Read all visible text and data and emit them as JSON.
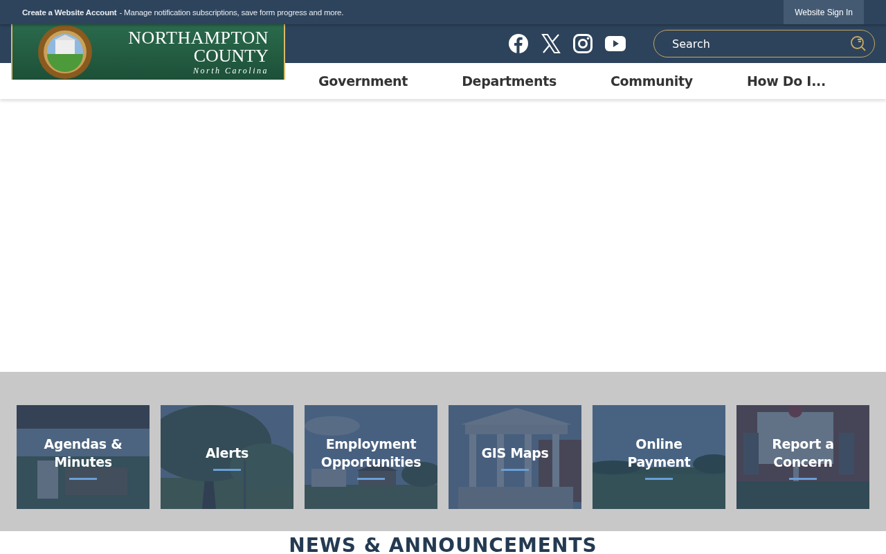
{
  "top_bar": {
    "account_link": "Create a Website Account",
    "message": "- Manage notification subscriptions, save form progress and more.",
    "sign_in": "Website Sign In"
  },
  "logo": {
    "title": "NORTHAMPTON",
    "subtitle": "COUNTY",
    "state": "North Carolina"
  },
  "social": [
    {
      "kind": "facebook"
    },
    {
      "kind": "x"
    },
    {
      "kind": "instagram"
    },
    {
      "kind": "youtube"
    }
  ],
  "search": {
    "placeholder": "Search"
  },
  "nav": [
    {
      "label": "Government"
    },
    {
      "label": "Departments"
    },
    {
      "label": "Community"
    },
    {
      "label": "How Do I..."
    }
  ],
  "tiles": [
    {
      "label": "Agendas & Minutes"
    },
    {
      "label": "Alerts"
    },
    {
      "label": "Employment Opportunities"
    },
    {
      "label": "GIS Maps"
    },
    {
      "label": "Online Payment"
    },
    {
      "label": "Report a Concern"
    }
  ],
  "news": {
    "heading": "NEWS & ANNOUNCEMENTS"
  }
}
